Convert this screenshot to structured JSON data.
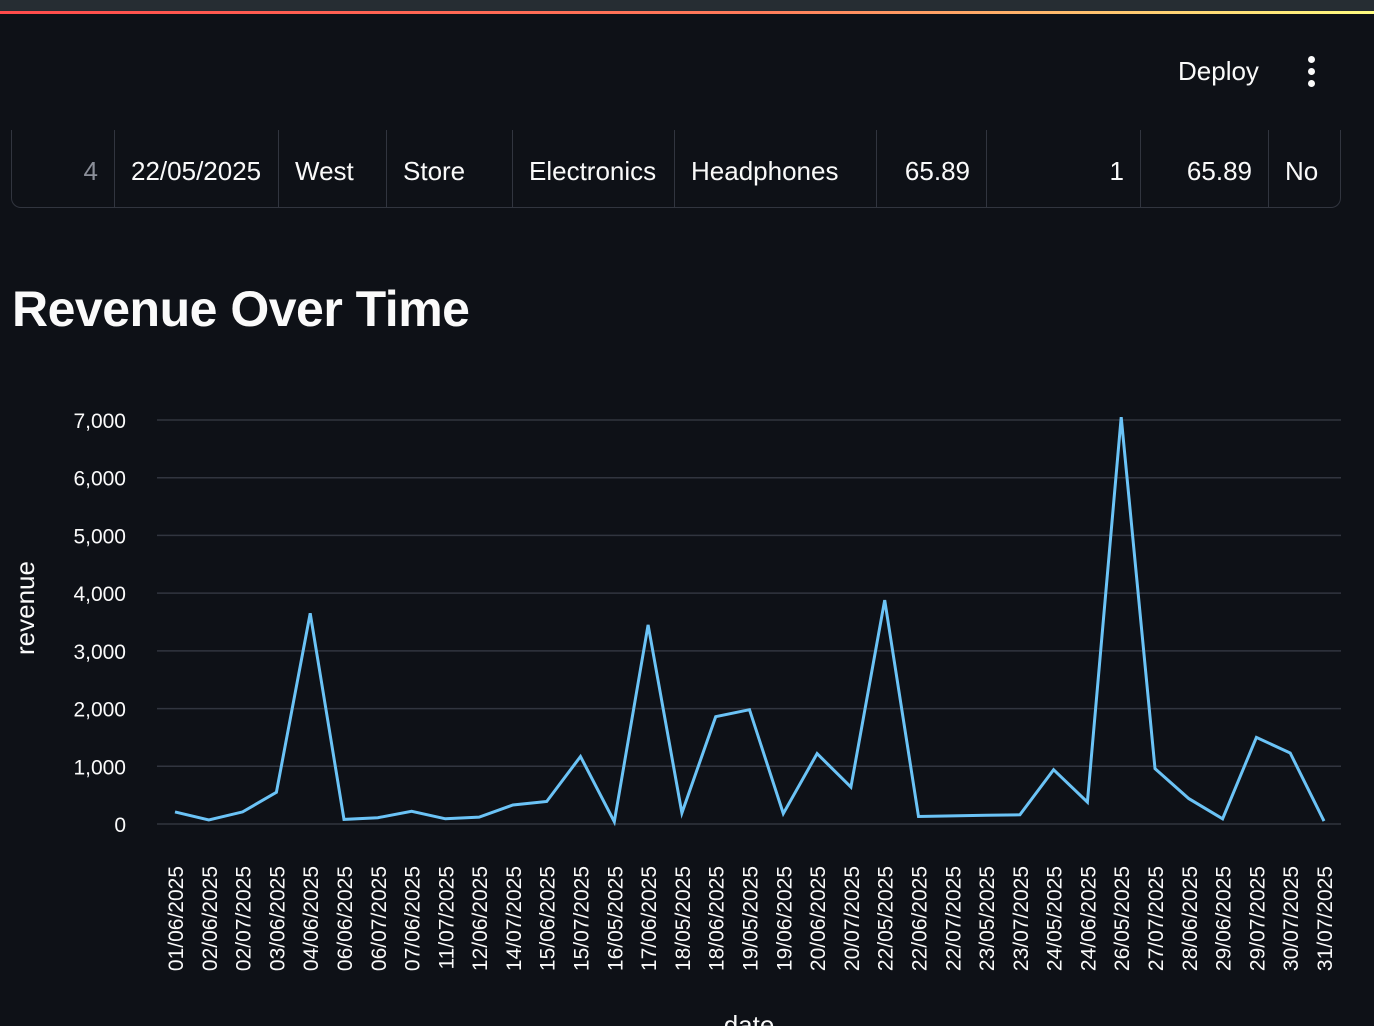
{
  "header": {
    "deploy_label": "Deploy",
    "menu_icon": "vertical-ellipsis-icon"
  },
  "table": {
    "row": {
      "index": "4",
      "date": "22/05/2025",
      "region": "West",
      "channel": "Store",
      "category": "Electronics",
      "product": "Headphones",
      "price": "65.89",
      "quantity": "1",
      "revenue": "65.89",
      "flag": "No"
    }
  },
  "section_title": "Revenue Over Time",
  "chart_data": {
    "type": "line",
    "title": "Revenue Over Time",
    "xlabel": "date",
    "ylabel": "revenue",
    "ylim": [
      0,
      7000
    ],
    "yticks": [
      0,
      1000,
      2000,
      3000,
      4000,
      5000,
      6000,
      7000
    ],
    "ytick_labels": [
      "0",
      "1,000",
      "2,000",
      "3,000",
      "4,000",
      "5,000",
      "6,000",
      "7,000"
    ],
    "grid": true,
    "line_color": "#6bc3f6",
    "categories": [
      "01/06/2025",
      "02/06/2025",
      "02/07/2025",
      "03/06/2025",
      "04/06/2025",
      "06/06/2025",
      "06/07/2025",
      "07/06/2025",
      "11/07/2025",
      "12/06/2025",
      "14/07/2025",
      "15/06/2025",
      "15/07/2025",
      "16/05/2025",
      "17/06/2025",
      "18/05/2025",
      "18/06/2025",
      "19/05/2025",
      "19/06/2025",
      "20/06/2025",
      "20/07/2025",
      "22/05/2025",
      "22/06/2025",
      "22/07/2025",
      "23/05/2025",
      "23/07/2025",
      "24/05/2025",
      "24/06/2025",
      "26/05/2025",
      "27/07/2025",
      "28/06/2025",
      "29/06/2025",
      "29/07/2025",
      "30/07/2025",
      "31/07/2025"
    ],
    "values": [
      210,
      70,
      210,
      550,
      3650,
      80,
      110,
      220,
      90,
      120,
      330,
      390,
      1170,
      40,
      3450,
      190,
      1860,
      1980,
      180,
      1220,
      640,
      3880,
      130,
      140,
      150,
      160,
      940,
      380,
      7050,
      960,
      440,
      90,
      1500,
      1230,
      50
    ]
  }
}
